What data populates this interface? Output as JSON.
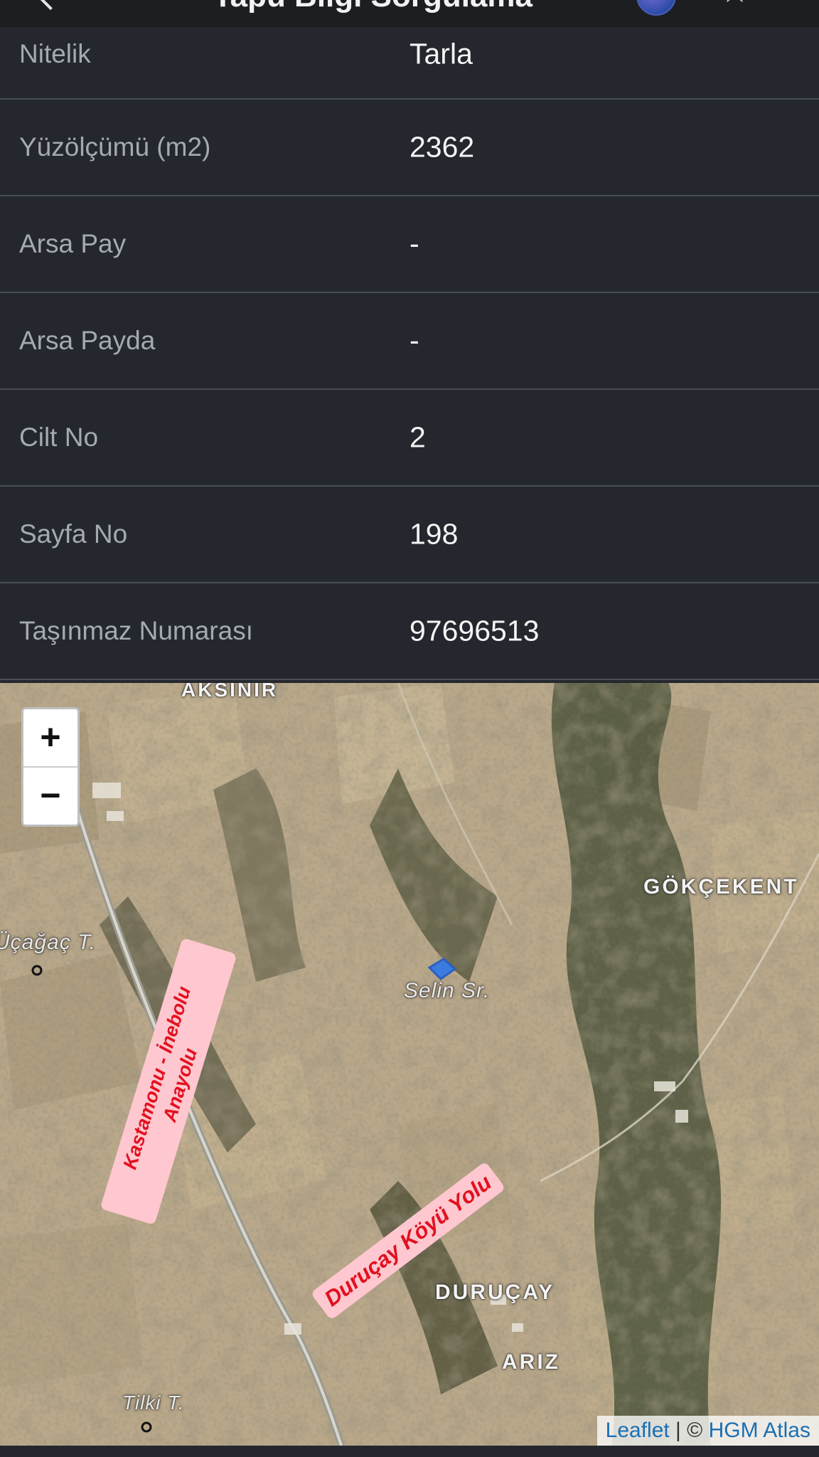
{
  "header": {
    "title": "Tapu Bilgi Sorgulama",
    "back_icon": "chevron-left-icon",
    "globe_icon": "globe-icon",
    "star_icon": "star-outline-icon"
  },
  "rows": [
    {
      "label": "Nitelik",
      "value": "Tarla"
    },
    {
      "label": "Yüzölçümü (m2)",
      "value": "2362"
    },
    {
      "label": "Arsa Pay",
      "value": "-"
    },
    {
      "label": "Arsa Payda",
      "value": "-"
    },
    {
      "label": "Cilt No",
      "value": "2"
    },
    {
      "label": "Sayfa No",
      "value": "198"
    },
    {
      "label": "Taşınmaz Numarası",
      "value": "97696513"
    }
  ],
  "map": {
    "zoom_in": "+",
    "zoom_out": "−",
    "places": {
      "aksinir": "AKSINIR",
      "gokcekent": "GÖKÇEKENT",
      "ucagac": "Üçağaç T.",
      "selin": "Selin Sr.",
      "durucay": "DURUÇAY",
      "ariz": "ARIZ",
      "tilki": "Tilki T."
    },
    "roads": {
      "kastamonu": "Kastamonu - İnebolu Anayolu",
      "durucay_road": "Duruçay Köyü Yolu"
    },
    "attribution": {
      "leaflet": "Leaflet",
      "separator": " | © ",
      "provider": "HGM Atlas"
    },
    "parcel_color": "#3b7be0"
  }
}
